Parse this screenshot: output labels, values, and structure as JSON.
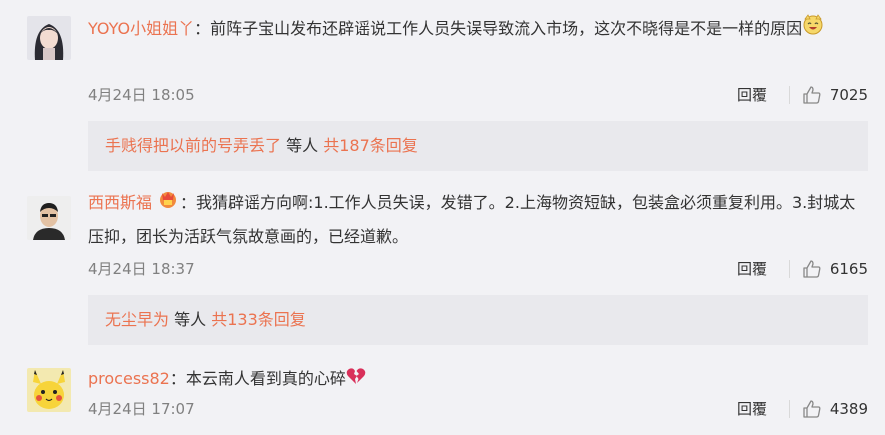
{
  "comments": [
    {
      "username": "YOYO小姐姐丫",
      "text": "：前阵子宝山发布还辟谣说工作人员失误导致流入市场，这次不晓得是不是一样的原因",
      "date": "4月24日 18:05",
      "reply_label": "回覆",
      "likes": "7025",
      "sub": {
        "user": "手贱得把以前的号弄丢了",
        "middle": " 等人 ",
        "count_text": "共187条回复"
      }
    },
    {
      "username": "西西斯福",
      "text": "：我猜辟谣方向啊:1.工作人员失误，发错了。2.上海物资短缺，包装盒必须重复利用。3.封城太压抑，团长为活跃气氛故意画的，已经道歉。",
      "date": "4月24日 18:37",
      "reply_label": "回覆",
      "likes": "6165",
      "sub": {
        "user": "无尘早为",
        "middle": " 等人 ",
        "count_text": "共133条回复"
      }
    },
    {
      "username": "process82",
      "text": "：本云南人看到真的心碎",
      "date": "4月24日 17:07",
      "reply_label": "回覆",
      "likes": "4389"
    }
  ],
  "colors": {
    "accent": "#eb7350",
    "background": "#f2f2f5",
    "subbox": "#e9e9ed"
  },
  "icons": [
    "avatar-girl",
    "laughing-dog-emoji",
    "avatar-man",
    "vip-badge-icon",
    "avatar-pikachu",
    "broken-heart-emoji",
    "thumbs-up-icon"
  ]
}
